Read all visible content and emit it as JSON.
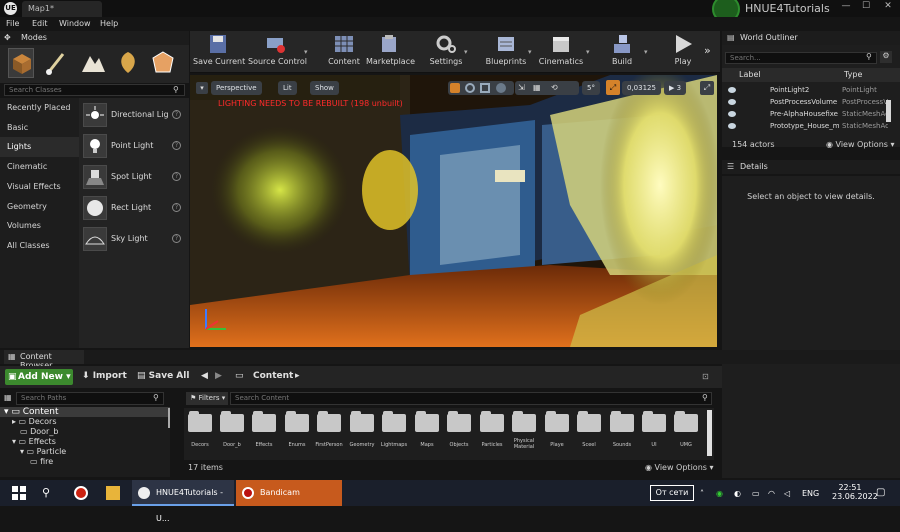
{
  "titlebar": {
    "app_logo": "UE",
    "tab": "Map1*",
    "project": "HNUE4Tutorials",
    "controls": [
      "—",
      "☐",
      "✕"
    ]
  },
  "menu": [
    "File",
    "Edit",
    "Window",
    "Help"
  ],
  "modes": {
    "title": "Modes",
    "search_placeholder": "Search Classes",
    "categories": [
      "Recently Placed",
      "Basic",
      "Lights",
      "Cinematic",
      "Visual Effects",
      "Geometry",
      "Volumes",
      "All Classes"
    ],
    "active_category": "Lights",
    "items": [
      "Directional Lig",
      "Point Light",
      "Spot Light",
      "Rect Light",
      "Sky Light"
    ]
  },
  "toolbar": [
    "Save Current",
    "Source Control",
    "Content",
    "Marketplace",
    "Settings",
    "Blueprints",
    "Cinematics",
    "Build",
    "Play"
  ],
  "viewport": {
    "perspective": "Perspective",
    "lit": "Lit",
    "show": "Show",
    "warning": "LIGHTING NEEDS TO BE REBUILT (198 unbuilt)",
    "angle": "5°",
    "scale": "0,03125",
    "speed": "3"
  },
  "world_outliner": {
    "title": "World Outliner",
    "search_placeholder": "Search...",
    "col_label": "Label",
    "col_type": "Type",
    "rows": [
      {
        "name": "PointLight2",
        "type": "PointLight"
      },
      {
        "name": "PostProcessVolume",
        "type": "PostProcessVolume"
      },
      {
        "name": "Pre-AlphaHousefixe",
        "type": "StaticMeshActor"
      },
      {
        "name": "Prototype_House_m",
        "type": "StaticMeshActor"
      }
    ],
    "actors": "154 actors",
    "view_options": "View Options"
  },
  "details": {
    "title": "Details",
    "message": "Select an object to view details."
  },
  "content_browser": {
    "title": "Content Browser",
    "add_new": "Add New",
    "import": "Import",
    "save_all": "Save All",
    "path": "Content",
    "search_paths": "Search Paths",
    "filters": "Filters",
    "search_content": "Search Content",
    "tree": [
      "Content",
      "Decors",
      "Door_b",
      "Effects",
      "Particle",
      "fire"
    ],
    "folders": [
      "Decors",
      "Door_b",
      "Effects",
      "Enums",
      "FirstPerson",
      "Geometry",
      "Lightmaps",
      "Maps",
      "Objects",
      "Particles",
      "Physical Material",
      "Playe",
      "Sceel",
      "Sounds",
      "UI",
      "UMG"
    ],
    "items_count": "17 items",
    "view_options": "View Options"
  },
  "taskbar": {
    "apps": [
      "HNUE4Tutorials - U...",
      "Bandicam"
    ],
    "network": "От сети",
    "lang": "ENG",
    "time": "22:51",
    "date": "23.06.2022"
  },
  "colors": {
    "accent_green": "#3c8a2e",
    "warning_red": "#ff2a2a",
    "bandicam_orange": "#c75a1d"
  }
}
